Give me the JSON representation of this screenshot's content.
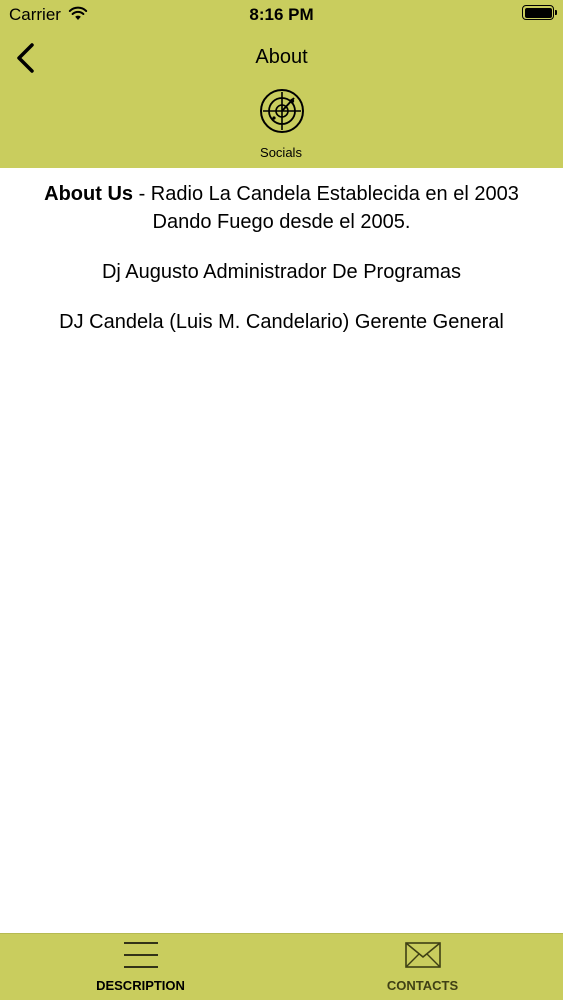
{
  "status_bar": {
    "carrier": "Carrier",
    "time": "8:16 PM"
  },
  "nav": {
    "title": "About"
  },
  "tabs": {
    "socials_label": "Socials"
  },
  "about": {
    "heading": "About Us",
    "text_line1": " - Radio La Candela Establecida en el 2003",
    "text_line2": "Dando Fuego desde el 2005.",
    "staff1": "Dj Augusto Administrador De Programas",
    "staff2": "DJ Candela (Luis M. Candelario) Gerente General"
  },
  "bottom_tabs": [
    {
      "label": "DESCRIPTION",
      "icon": "menu-lines-icon"
    },
    {
      "label": "CONTACTS",
      "icon": "envelope-icon"
    }
  ],
  "colors": {
    "accent": "#c9cd5e",
    "background": "#ffffff"
  }
}
